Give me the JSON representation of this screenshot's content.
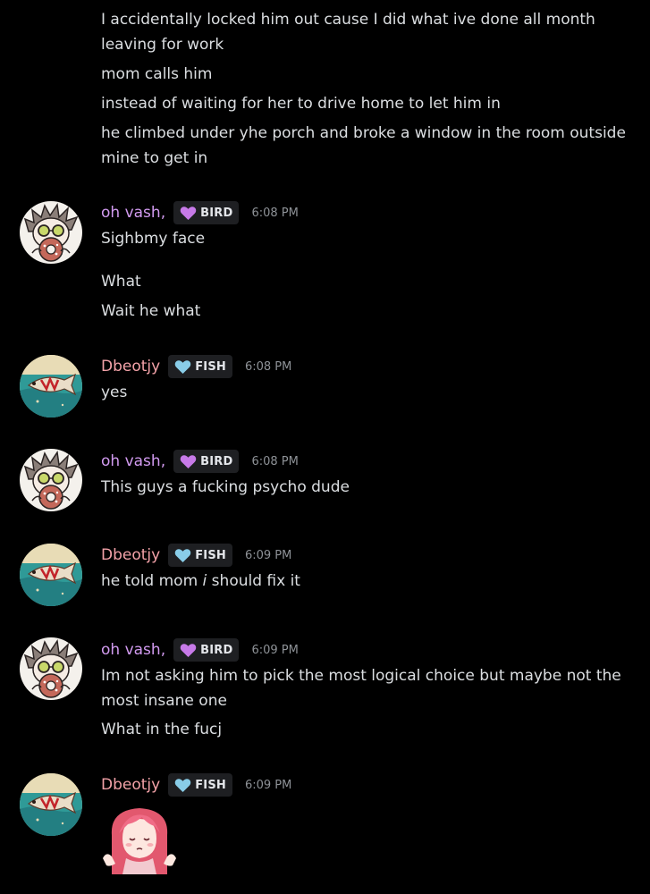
{
  "colors": {
    "background": "#000000",
    "text": "#dbdee1",
    "timestamp": "#8e9297",
    "vash_name": "#d29bf0",
    "dbeotjy_name": "#f3a2a8",
    "bird_heart": "#c77ae8",
    "fish_heart": "#89cde8",
    "tag_background": "#1e1f22"
  },
  "intro_lines": [
    "I accidentally locked him out cause I did what ive done all month leaving for work",
    "mom calls him",
    "instead of waiting for her to drive home to let him in",
    "he climbed under yhe porch and broke a window in the room outside mine to get in"
  ],
  "messages": [
    {
      "author": "oh vash,",
      "tag": "BIRD",
      "tag_icon": "purple-heart-icon",
      "time": "6:08 PM",
      "avatar": "orange-haired-character-avatar",
      "lines": [
        "Sighbmy face",
        "What",
        "Wait he what"
      ]
    },
    {
      "author": "Dbeotjy",
      "tag": "FISH",
      "tag_icon": "blue-heart-icon",
      "time": "6:08 PM",
      "avatar": "fish-painting-avatar",
      "lines": [
        "yes"
      ]
    },
    {
      "author": "oh vash,",
      "tag": "BIRD",
      "tag_icon": "purple-heart-icon",
      "time": "6:08 PM",
      "avatar": "orange-haired-character-avatar",
      "lines": [
        "This guys a fucking psycho dude"
      ]
    },
    {
      "author": "Dbeotjy",
      "tag": "FISH",
      "tag_icon": "blue-heart-icon",
      "time": "6:09 PM",
      "avatar": "fish-painting-avatar",
      "lines": [
        {
          "before": "he told mom ",
          "emphasis": "i",
          "after": " should fix it"
        }
      ]
    },
    {
      "author": "oh vash,",
      "tag": "BIRD",
      "tag_icon": "purple-heart-icon",
      "time": "6:09 PM",
      "avatar": "orange-haired-character-avatar",
      "lines": [
        "Im not asking him to pick the most logical choice but maybe not the most insane one",
        "What in the fucj"
      ]
    },
    {
      "author": "Dbeotjy",
      "tag": "FISH",
      "tag_icon": "blue-heart-icon",
      "time": "6:09 PM",
      "avatar": "fish-painting-avatar",
      "lines": [],
      "sticker": "pink-haired-girl-shrug-sticker"
    }
  ]
}
